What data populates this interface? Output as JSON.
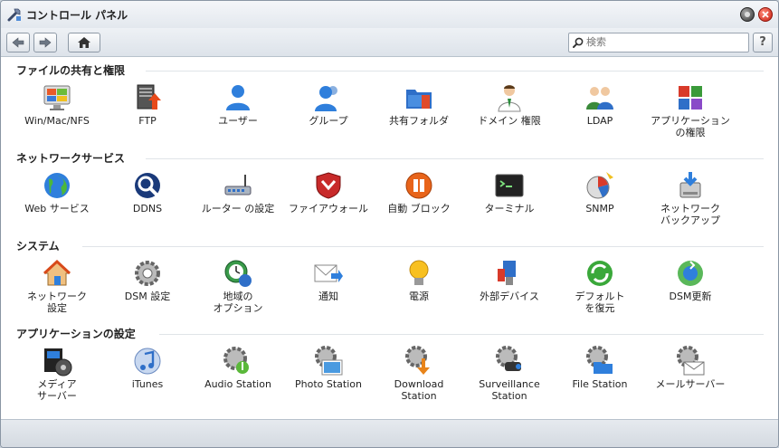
{
  "window": {
    "title": "コントロール パネル"
  },
  "toolbar": {
    "search_placeholder": "検索",
    "help_label": "?"
  },
  "sections": [
    {
      "title": "ファイルの共有と権限",
      "items": [
        {
          "label": "Win/Mac/NFS",
          "icon": "win-mac-nfs-icon"
        },
        {
          "label": "FTP",
          "icon": "ftp-icon"
        },
        {
          "label": "ユーザー",
          "icon": "user-icon"
        },
        {
          "label": "グループ",
          "icon": "group-icon"
        },
        {
          "label": "共有フォルダ",
          "icon": "shared-folder-icon"
        },
        {
          "label": "ドメイン 権限",
          "icon": "domain-privilege-icon"
        },
        {
          "label": "LDAP",
          "icon": "ldap-icon"
        },
        {
          "label": "アプリケーション\nの権限",
          "icon": "application-privilege-icon"
        }
      ]
    },
    {
      "title": "ネットワークサービス",
      "items": [
        {
          "label": "Web サービス",
          "icon": "web-service-icon"
        },
        {
          "label": "DDNS",
          "icon": "ddns-icon"
        },
        {
          "label": "ルーター の設定",
          "icon": "router-icon"
        },
        {
          "label": "ファイアウォール",
          "icon": "firewall-icon"
        },
        {
          "label": "自動 ブロック",
          "icon": "auto-block-icon"
        },
        {
          "label": "ターミナル",
          "icon": "terminal-icon"
        },
        {
          "label": "SNMP",
          "icon": "snmp-icon"
        },
        {
          "label": "ネットワーク\nバックアップ",
          "icon": "network-backup-icon"
        }
      ]
    },
    {
      "title": "システム",
      "items": [
        {
          "label": "ネットワーク\n設定",
          "icon": "network-settings-icon"
        },
        {
          "label": "DSM 設定",
          "icon": "dsm-settings-icon"
        },
        {
          "label": "地域の\nオプション",
          "icon": "regional-options-icon"
        },
        {
          "label": "通知",
          "icon": "notification-icon"
        },
        {
          "label": "電源",
          "icon": "power-icon"
        },
        {
          "label": "外部デバイス",
          "icon": "external-device-icon"
        },
        {
          "label": "デフォルト\nを復元",
          "icon": "restore-defaults-icon"
        },
        {
          "label": "DSM更新",
          "icon": "dsm-update-icon"
        }
      ]
    },
    {
      "title": "アプリケーションの設定",
      "items": [
        {
          "label": "メディア\nサーバー",
          "icon": "media-server-icon"
        },
        {
          "label": "iTunes",
          "icon": "itunes-icon"
        },
        {
          "label": "Audio Station",
          "icon": "audio-station-icon"
        },
        {
          "label": "Photo Station",
          "icon": "photo-station-icon"
        },
        {
          "label": "Download\nStation",
          "icon": "download-station-icon"
        },
        {
          "label": "Surveillance\nStation",
          "icon": "surveillance-station-icon"
        },
        {
          "label": "File Station",
          "icon": "file-station-icon"
        },
        {
          "label": "メールサーバー",
          "icon": "mail-server-icon"
        }
      ]
    }
  ]
}
